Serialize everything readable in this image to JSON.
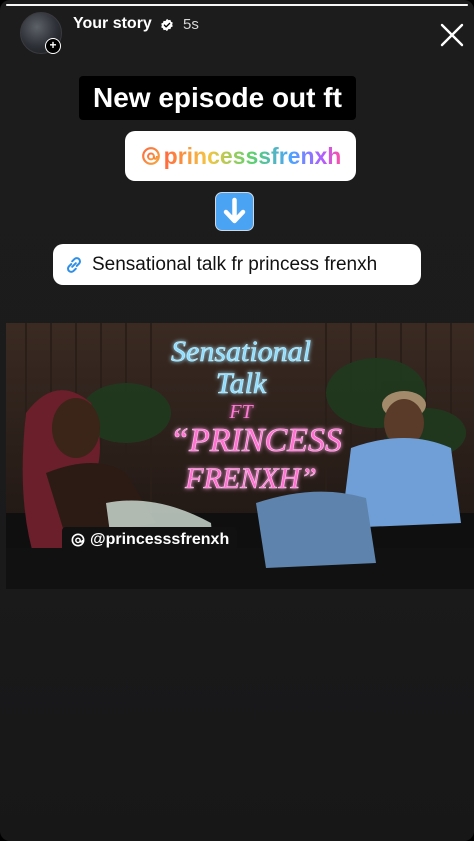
{
  "header": {
    "username": "Your story",
    "time": "5s",
    "progress": 1.0
  },
  "icons": {
    "close": "close-icon",
    "verified": "verified-badge-icon",
    "threads": "threads-icon",
    "link": "link-icon",
    "down_arrow": "down-arrow-emoji"
  },
  "story": {
    "headline": "New episode out ft",
    "mention_sticker": "princesssfrenxh",
    "link_sticker": "Sensational talk fr princess frenxh",
    "image_tag": "@princesssfrenxh",
    "neon_title_line1": "Sensational",
    "neon_title_line2": "Talk",
    "neon_ft": "FT",
    "neon_guest_line1": "“PRINCESS",
    "neon_guest_line2": "FRENXH”"
  },
  "colors": {
    "background": "#1b1b1c",
    "neon_blue": "#7fd6ff",
    "neon_pink": "#ff5fc8",
    "emoji_blue": "#4aa3f3"
  }
}
